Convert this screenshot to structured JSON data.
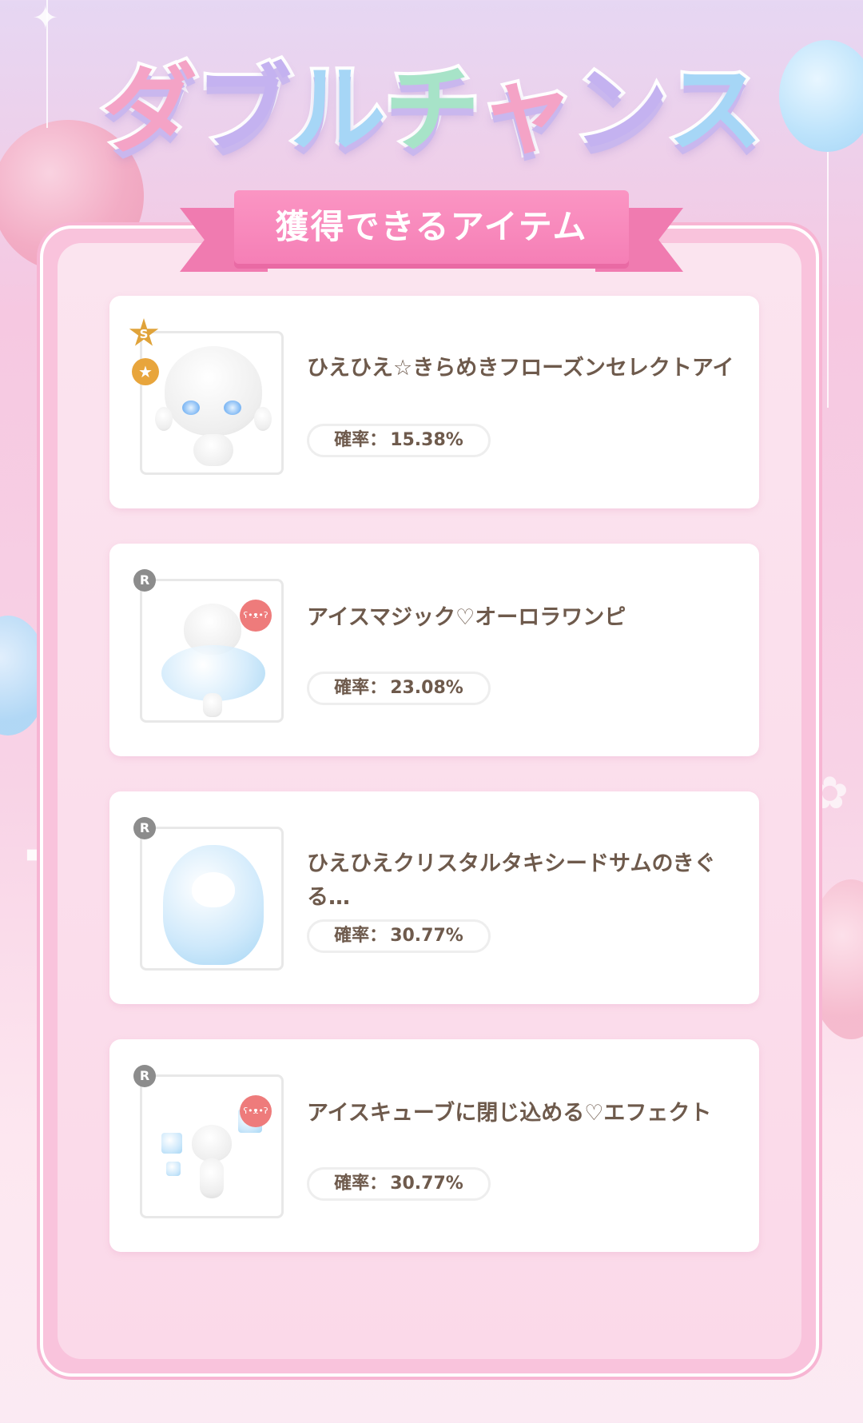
{
  "title": {
    "chars": [
      "ダ",
      "ブ",
      "ル",
      "チ",
      "ャ",
      "ン",
      "ス"
    ],
    "colors": [
      "#f4a3c6",
      "#c4b2f0",
      "#a6d6f6",
      "#a7e3c8",
      "#f4a3c6",
      "#c4b2f0",
      "#a6d6f6"
    ]
  },
  "ribbon": {
    "label": "獲得できるアイテム"
  },
  "items": [
    {
      "rank": "S",
      "name": "ひえひえ☆きらめきフローズンセレクトアイ",
      "rate_label": "確率：",
      "rate_value": "15.38%",
      "badge": "star"
    },
    {
      "rank": "R",
      "name": "アイスマジック♡オーロラワンピ",
      "rate_label": "確率：",
      "rate_value": "23.08%",
      "badge": "bear"
    },
    {
      "rank": "R",
      "name": "ひえひえクリスタルタキシードサムのきぐる…",
      "rate_label": "確率：",
      "rate_value": "30.77%",
      "badge": ""
    },
    {
      "rank": "R",
      "name": "アイスキューブに閉じ込める♡エフェクト",
      "rate_label": "確率：",
      "rate_value": "30.77%",
      "badge": "bear"
    }
  ],
  "icons": {
    "rank_s": "star-rank-icon",
    "rank_r": "rank-r-icon",
    "star_badge": "star-badge-icon",
    "bear_badge": "bear-badge-icon"
  },
  "colors": {
    "accent_pink": "#f57fb6",
    "text_brown": "#6e5a4c",
    "rank_gold": "#e0a33a",
    "rank_gray": "#8c8c8c",
    "bear_red": "#ee7b7b"
  }
}
